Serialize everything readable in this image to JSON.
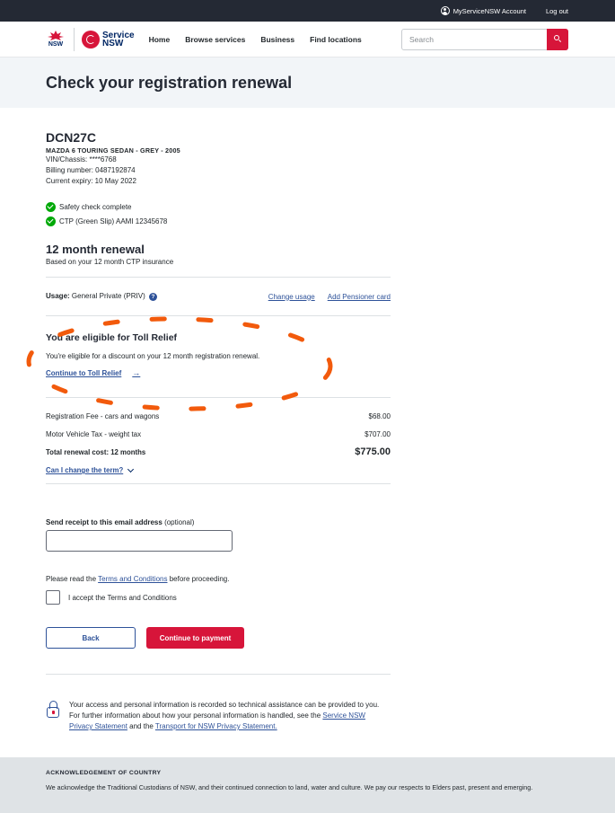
{
  "topbar": {
    "account_label": "MyServiceNSW Account",
    "logout_label": "Log out"
  },
  "header": {
    "nsw_logo_text": "NSW",
    "brand_line1": "Service",
    "brand_line2": "NSW",
    "nav": [
      "Home",
      "Browse services",
      "Business",
      "Find locations"
    ],
    "search_placeholder": "Search"
  },
  "hero": {
    "title": "Check your registration renewal"
  },
  "vehicle": {
    "plate": "DCN27C",
    "description": "MAZDA 6 TOURING SEDAN - GREY - 2005",
    "vin": "VIN/Chassis: ****6768",
    "billing": "Billing number: 0487192874",
    "expiry": "Current expiry: 10 May 2022",
    "checks": [
      "Safety check complete",
      "CTP (Green Slip) AAMI 12345678"
    ]
  },
  "renewal": {
    "title": "12 month renewal",
    "subtitle": "Based on your 12 month CTP insurance",
    "usage_label": "Usage:",
    "usage_value": "General Private (PRIV)",
    "help_glyph": "?",
    "change_usage": "Change usage",
    "add_pensioner": "Add Pensioner card"
  },
  "toll": {
    "title": "You are eligible for Toll Relief",
    "text": "You're eligible for a discount on your 12 month registration renewal.",
    "button": "Continue to Toll Relief",
    "arrow": "→"
  },
  "fees": [
    {
      "label": "Registration Fee - cars and wagons",
      "amount": "$68.00"
    },
    {
      "label": "Motor Vehicle Tax - weight tax",
      "amount": "$707.00"
    }
  ],
  "total": {
    "label": "Total renewal cost: 12 months",
    "amount": "$775.00"
  },
  "term_link": "Can I change the term?",
  "email": {
    "label": "Send receipt to this email address",
    "optional": "(optional)",
    "value": ""
  },
  "terms": {
    "prefix": "Please read the ",
    "link": "Terms and Conditions",
    "suffix": " before proceeding.",
    "accept_label": "I accept the Terms and Conditions",
    "checked": false
  },
  "buttons": {
    "back": "Back",
    "continue": "Continue to payment"
  },
  "privacy": {
    "text1": "Your access and personal information is recorded so technical assistance can be provided to you. For further information about how your personal information is handled, see the ",
    "link1": "Service NSW Privacy Statement",
    "mid": " and the ",
    "link2": "Transport for NSW Privacy Statement."
  },
  "ack": {
    "title": "ACKNOWLEDGEMENT OF COUNTRY",
    "text": "We acknowledge the Traditional Custodians of NSW, and their continued connection to land, water and culture. We pay our respects to Elders past, present and emerging."
  },
  "colors": {
    "brand_red": "#d7153a",
    "navy": "#002664",
    "link": "#2e5299",
    "success": "#00a908",
    "highlight_orange": "#f25a0c"
  }
}
